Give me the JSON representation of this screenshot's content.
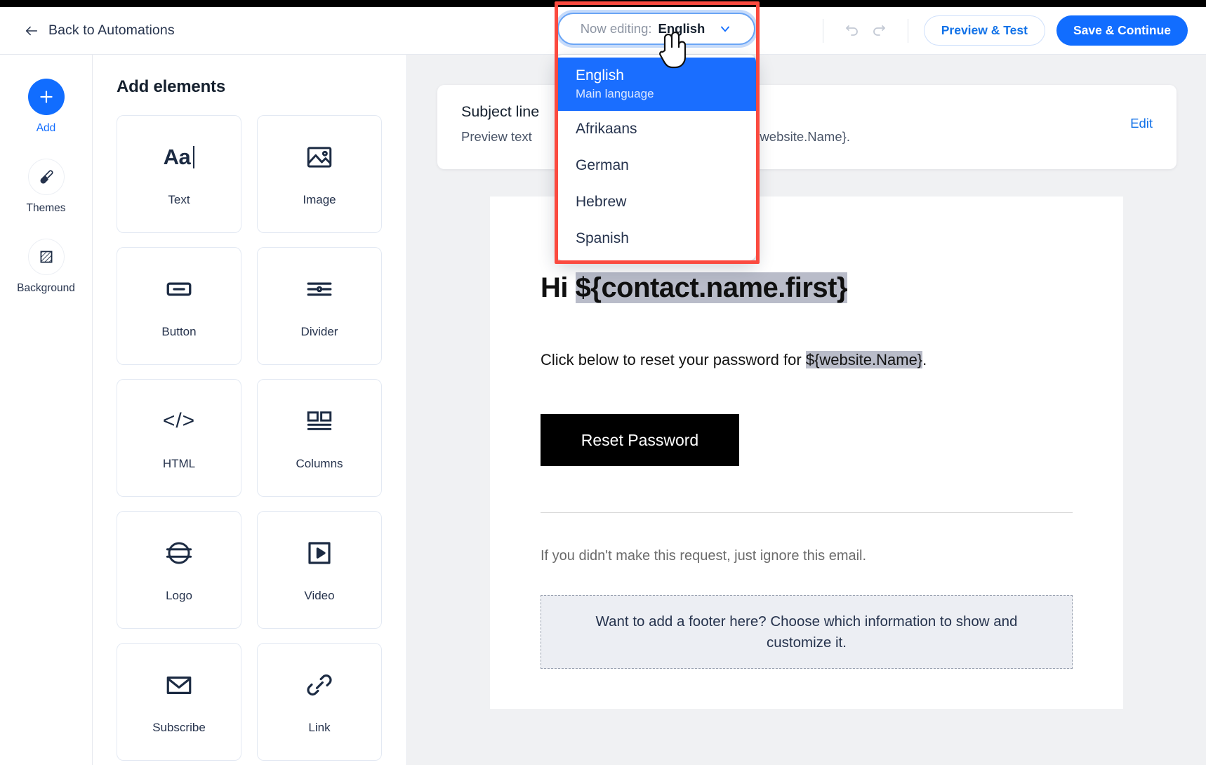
{
  "topbar": {
    "back_label": "Back to Automations",
    "back_icon": "arrow-left-icon",
    "undo_icon": "undo-icon",
    "redo_icon": "redo-icon",
    "preview_test_label": "Preview & Test",
    "save_continue_label": "Save & Continue"
  },
  "language_selector": {
    "prefix_label": "Now editing:",
    "current_value": "English",
    "chevron_icon": "chevron-down-icon",
    "cursor_icon": "pointer-hand-cursor",
    "options": [
      {
        "label": "English",
        "sub": "Main language",
        "selected": true
      },
      {
        "label": "Afrikaans",
        "sub": "",
        "selected": false
      },
      {
        "label": "German",
        "sub": "",
        "selected": false
      },
      {
        "label": "Hebrew",
        "sub": "",
        "selected": false
      },
      {
        "label": "Spanish",
        "sub": "",
        "selected": false
      }
    ]
  },
  "annotation": {
    "color": "#fb4a3f"
  },
  "rail": {
    "items": [
      {
        "label": "Add",
        "icon": "plus-icon",
        "active": true
      },
      {
        "label": "Themes",
        "icon": "paintbrush-icon",
        "active": false
      },
      {
        "label": "Background",
        "icon": "hatched-square-icon",
        "active": false
      }
    ]
  },
  "panel": {
    "title": "Add elements",
    "elements": [
      {
        "label": "Text",
        "icon": "text-aa-icon"
      },
      {
        "label": "Image",
        "icon": "image-icon"
      },
      {
        "label": "Button",
        "icon": "button-icon"
      },
      {
        "label": "Divider",
        "icon": "divider-icon"
      },
      {
        "label": "HTML",
        "icon": "code-icon"
      },
      {
        "label": "Columns",
        "icon": "columns-icon"
      },
      {
        "label": "Logo",
        "icon": "logo-icon"
      },
      {
        "label": "Video",
        "icon": "video-icon"
      },
      {
        "label": "Subscribe",
        "icon": "envelope-icon"
      },
      {
        "label": "Link",
        "icon": "link-icon"
      }
    ]
  },
  "subject_card": {
    "subject_line": "Subject line",
    "preview_text": "Preview text",
    "preview_tail": "password for ${website.Name}.",
    "edit_label": "Edit"
  },
  "email": {
    "heading_prefix": "Hi ",
    "heading_variable": "${contact.name.first}",
    "body_prefix": "Click below to reset your password for ",
    "body_variable": "${website.Name}",
    "body_suffix": ".",
    "cta_label": "Reset Password",
    "note": "If you didn't make this request, just ignore this email.",
    "footer_placeholder": "Want to add a footer here? Choose which information to show and customize it."
  },
  "colors": {
    "accent_blue": "#116dff",
    "annotation_red": "#fb4a3f",
    "cta_black": "#000000",
    "canvas_gray": "#f0f1f3"
  }
}
